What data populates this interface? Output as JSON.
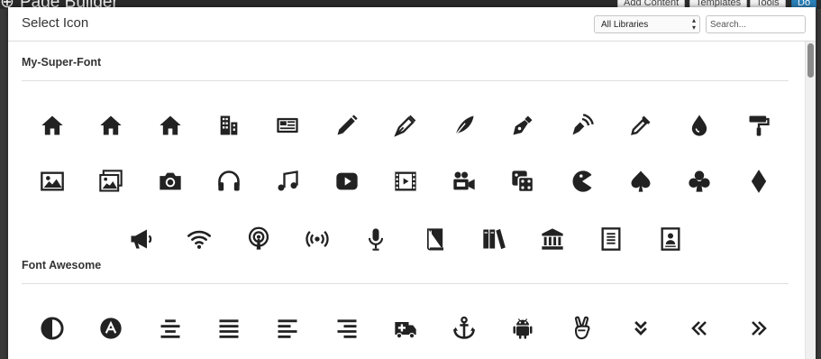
{
  "background": {
    "title": "Page Builder",
    "buttons": [
      "Add Content",
      "Templates",
      "Tools",
      "Do"
    ]
  },
  "modal": {
    "title": "Select Icon",
    "library_select": {
      "value": "All Libraries"
    },
    "search": {
      "placeholder": "Search..."
    }
  },
  "sections": [
    {
      "title": "My-Super-Font",
      "rows": [
        [
          "home-icon",
          "home-icon",
          "home-icon",
          "building-icon",
          "newspaper-icon",
          "pencil-icon",
          "pen-nib-icon",
          "feather-icon",
          "fountain-pen-icon",
          "pen-signal-icon",
          "eyedropper-icon",
          "droplet-icon",
          "paint-roller-icon"
        ],
        [
          "image-icon",
          "images-icon",
          "camera-icon",
          "headphones-icon",
          "music-icon",
          "play-icon",
          "film-icon",
          "video-camera-icon",
          "dice-icon",
          "pacman-icon",
          "spade-icon",
          "club-icon",
          "diamond-icon"
        ],
        [
          "bullhorn-icon",
          "wifi-icon",
          "podcast-icon",
          "feed-icon",
          "mic-icon",
          "book-icon",
          "books-icon",
          "library-icon",
          "file-text-icon",
          "profile-icon"
        ]
      ]
    },
    {
      "title": "Font Awesome",
      "rows": [
        [
          "adjust-icon",
          "adn-icon",
          "align-center-icon",
          "align-justify-icon",
          "align-left-icon",
          "align-right-icon",
          "ambulance-icon",
          "anchor-icon",
          "android-icon",
          "angellist-icon",
          "angle-double-down-icon",
          "angle-double-left-icon",
          "angle-double-right-icon"
        ]
      ]
    }
  ],
  "colors": {
    "icon": "#222222",
    "rule": "#dedede",
    "text": "#333333"
  }
}
